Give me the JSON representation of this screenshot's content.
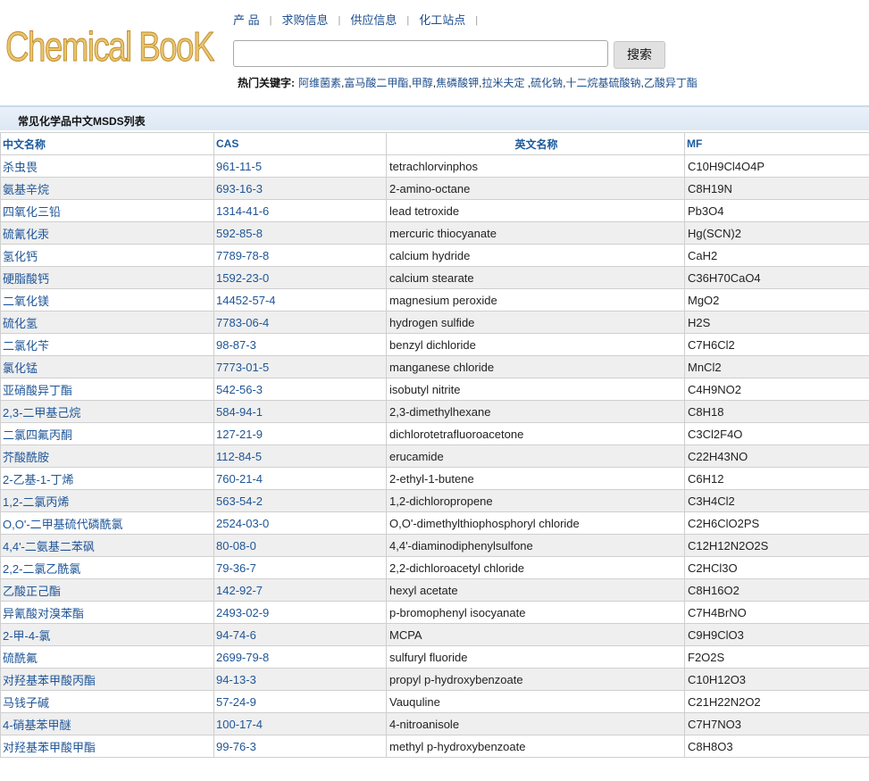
{
  "logo_text": "Chemical BooK",
  "nav": [
    "产 品",
    "求购信息",
    "供应信息",
    "化工站点"
  ],
  "nav_separator": "|",
  "search": {
    "value": "",
    "placeholder": "",
    "button_label": "搜索"
  },
  "hot_keywords": {
    "label": "热门关键字:",
    "items": [
      "阿维菌素",
      "富马酸二甲酯",
      "甲醇",
      "焦磷酸钾",
      "拉米夫定 ",
      "硫化钠",
      "十二烷基硫酸钠",
      "乙酸异丁酯"
    ]
  },
  "section_title": "常见化学品中文MSDS列表",
  "table": {
    "headers": [
      "中文名称",
      "CAS",
      "英文名称",
      "MF"
    ],
    "rows": [
      [
        "杀虫畏",
        "961-11-5",
        "tetrachlorvinphos",
        "C10H9Cl4O4P"
      ],
      [
        "氨基辛烷",
        "693-16-3",
        "2-amino-octane",
        "C8H19N"
      ],
      [
        "四氧化三铅",
        "1314-41-6",
        "lead tetroxide",
        "Pb3O4"
      ],
      [
        "硫氰化汞",
        "592-85-8",
        "mercuric thiocyanate",
        "Hg(SCN)2"
      ],
      [
        "氢化钙",
        "7789-78-8",
        "calcium hydride",
        "CaH2"
      ],
      [
        "硬脂酸钙",
        "1592-23-0",
        "calcium stearate",
        "C36H70CaO4"
      ],
      [
        "二氧化镁",
        "14452-57-4",
        "magnesium peroxide",
        "MgO2"
      ],
      [
        "硫化氢",
        "7783-06-4",
        "hydrogen sulfide",
        "H2S"
      ],
      [
        "二氯化苄",
        "98-87-3",
        "benzyl dichloride",
        "C7H6Cl2"
      ],
      [
        "氯化锰",
        "7773-01-5",
        "manganese chloride",
        "MnCl2"
      ],
      [
        "亚硝酸异丁酯",
        "542-56-3",
        "isobutyl nitrite",
        "C4H9NO2"
      ],
      [
        "2,3-二甲基己烷",
        "584-94-1",
        "2,3-dimethylhexane",
        "C8H18"
      ],
      [
        "二氯四氟丙酮",
        "127-21-9",
        "dichlorotetrafluoroacetone",
        "C3Cl2F4O"
      ],
      [
        "芥酸酰胺",
        "112-84-5",
        "erucamide",
        "C22H43NO"
      ],
      [
        "2-乙基-1-丁烯",
        "760-21-4",
        "2-ethyl-1-butene",
        "C6H12"
      ],
      [
        "1,2-二氯丙烯",
        "563-54-2",
        "1,2-dichloropropene",
        "C3H4Cl2"
      ],
      [
        "O,O'-二甲基硫代磷酰氯",
        "2524-03-0",
        "O,O'-dimethylthiophosphoryl chloride",
        "C2H6ClO2PS"
      ],
      [
        "4,4'-二氨基二苯砜",
        "80-08-0",
        "4,4'-diaminodiphenylsulfone",
        "C12H12N2O2S"
      ],
      [
        "2,2-二氯乙酰氯",
        "79-36-7",
        "2,2-dichloroacetyl chloride",
        "C2HCl3O"
      ],
      [
        "乙酸正己酯",
        "142-92-7",
        "hexyl acetate",
        "C8H16O2"
      ],
      [
        "异氰酸对溴苯酯",
        "2493-02-9",
        "p-bromophenyl isocyanate",
        "C7H4BrNO"
      ],
      [
        "2-甲-4-氯",
        "94-74-6",
        "MCPA",
        "C9H9ClO3"
      ],
      [
        "硫酰氟",
        "2699-79-8",
        "sulfuryl fluoride",
        "F2O2S"
      ],
      [
        "对羟基苯甲酸丙酯",
        "94-13-3",
        "propyl p-hydroxybenzoate",
        "C10H12O3"
      ],
      [
        "马钱子碱",
        "57-24-9",
        "Vauquline",
        "C21H22N2O2"
      ],
      [
        "4-硝基苯甲醚",
        "100-17-4",
        "4-nitroanisole",
        "C7H7NO3"
      ],
      [
        "对羟基苯甲酸甲酯",
        "99-76-3",
        "methyl p-hydroxybenzoate",
        "C8H8O3"
      ]
    ]
  }
}
